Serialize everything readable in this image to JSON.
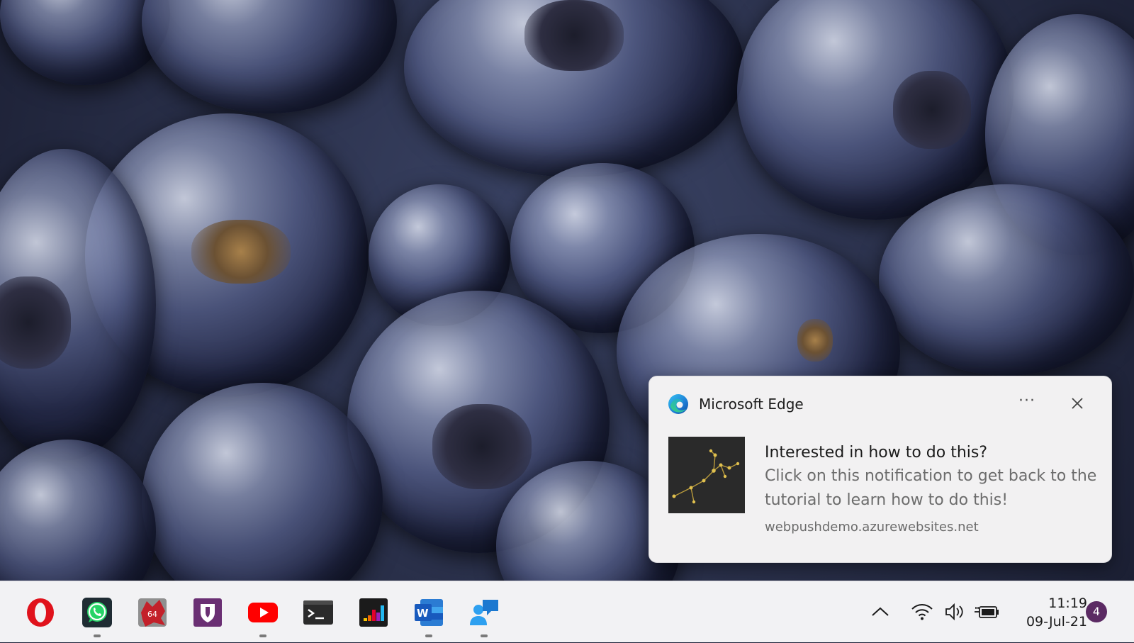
{
  "notification": {
    "app_name": "Microsoft Edge",
    "more_glyph": "···",
    "title": "Interested in how to do this?",
    "message": "Click on this notification to get back to the tutorial to learn how to do this!",
    "source": "webpushdemo.azurewebsites.net",
    "image_icon": "constellation-image"
  },
  "taskbar": {
    "apps": [
      {
        "name": "opera-icon",
        "running": false
      },
      {
        "name": "whatsapp-icon",
        "running": true
      },
      {
        "name": "aida64-icon",
        "running": false
      },
      {
        "name": "bitwarden-icon",
        "running": false
      },
      {
        "name": "youtube-icon",
        "running": true
      },
      {
        "name": "terminal-icon",
        "running": false
      },
      {
        "name": "deezer-icon",
        "running": false
      },
      {
        "name": "word-icon",
        "running": true
      },
      {
        "name": "feedback-hub-icon",
        "running": true
      }
    ],
    "tray": {
      "chevron": "chevron-up-icon",
      "wifi": "wifi-icon",
      "volume": "speaker-icon",
      "power": "battery-plug-icon"
    },
    "clock": {
      "time": "11:19",
      "date": "09-Jul-21"
    },
    "notification_count": "4"
  },
  "colors": {
    "toast_bg": "#f2f1f2",
    "taskbar_bg": "#f2f2f4",
    "badge": "#5b2a63"
  }
}
